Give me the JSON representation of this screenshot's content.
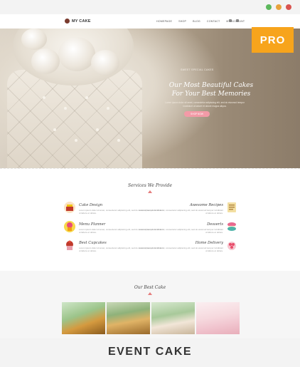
{
  "window_controls": {
    "colors": [
      "#5cb85c",
      "#e8a33d",
      "#d9534f"
    ]
  },
  "header": {
    "logo_text": "MY CAKE",
    "nav": [
      "HOMEPAGE",
      "SHOP",
      "BLOG",
      "CONTACT",
      "MY ACCOUNT"
    ]
  },
  "badge": {
    "label": "PRO",
    "color": "#f7a41c"
  },
  "hero": {
    "subtitle": "SWEET SPECIAL CAKES",
    "title_line1": "Our Most Beautiful Cakes",
    "title_line2": "For Your Best Memories",
    "description": "Lorem ipsum dolor sit amet, consectetur adipiscing elit, sed do eiusmod tempor incididunt ut labore et dolore magna aliqua.",
    "button_label": "SHOP NOW"
  },
  "services": {
    "title": "Services We Provide",
    "left": [
      {
        "title": "Cake Design",
        "desc": "Lorem ipsum dolor sit amet, consectetur adipiscing elit, sed do eiusmod tempor incididunt ut labore et dolore."
      },
      {
        "title": "Menu Planner",
        "desc": "Lorem ipsum dolor sit amet, consectetur adipiscing elit, sed do eiusmod tempor incididunt ut labore et dolore."
      },
      {
        "title": "Best Cupcakes",
        "desc": "Lorem ipsum dolor sit amet, consectetur adipiscing elit, sed do eiusmod tempor incididunt ut labore et dolore."
      }
    ],
    "right": [
      {
        "title": "Awesome Recipes",
        "desc": "Lorem ipsum dolor sit amet, consectetur adipiscing elit, sed do eiusmod tempor incididunt ut labore et dolore."
      },
      {
        "title": "Desserts",
        "desc": "Lorem ipsum dolor sit amet, consectetur adipiscing elit, sed do eiusmod tempor incididunt ut labore et dolore."
      },
      {
        "title": "Home Delivery",
        "desc": "Lorem ipsum dolor sit amet, consectetur adipiscing elit, sed do eiusmod tempor incididunt ut labore et dolore."
      }
    ]
  },
  "best_cake": {
    "title": "Our Best Cake"
  },
  "theme_name": "EVENT CAKE",
  "accent_color": "#f39aa7"
}
